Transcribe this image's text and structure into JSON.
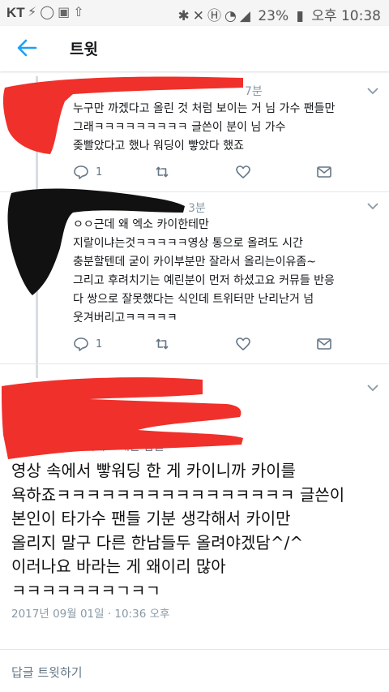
{
  "status_bar": {
    "carrier": "KT",
    "left_icons": [
      "notification-icon",
      "chat-icon",
      "image-icon",
      "upload-icon"
    ],
    "battery": "23%",
    "time": "오후 10:38",
    "right_icons": [
      "bluetooth-icon",
      "mute-icon",
      "hd-icon",
      "wifi-icon",
      "signal-icon",
      "battery-icon"
    ]
  },
  "app_bar": {
    "title": "트윗"
  },
  "tweets": [
    {
      "time": "7분",
      "lines": [
        "누구만 까겠다고 올린 것 처럼 보이는 거 님 가수 팬들만",
        "그래ㅋㅋㅋㅋㅋㅋㅋㅋㅋ 글쓴이 분이 님 가수",
        "좆빨았다고 했나 워딩이 빻았다 했죠"
      ],
      "reply_count": "1"
    },
    {
      "time": "3분",
      "lines": [
        "ㅇㅇ근데 왜 엑소 카이한테만",
        "지랄이냐는것ㅋㅋㅋㅋㅋ영상 통으로 올려도 시간",
        "충분할텐데 굳이 카이부분만 잘라서 올리는이유좀~",
        "그리고 후려치기는 예린분이 먼저 하셨고요 커뮤들 반응",
        "다 쌍으로 잘못했다는 식인데 트위터만 난리난거 넘",
        "웃겨버리고ㅋㅋㅋㅋㅋ"
      ],
      "reply_count": "1"
    }
  ],
  "main_tweet": {
    "reply_to": "에게 보내는 답글",
    "lines": [
      "영상 속에서 빻워딩 한 게 카이니까 카이를",
      "욕하죠ㅋㅋㅋㅋㅋㅋㅋㅋㅋㅋㅋㅋㅋㅋㅋㅋ 글쓴이",
      "본인이 타가수 팬들 기분 생각해서 카이만",
      "올리지 말구 다른 한남들두 올려야겠담^/^",
      "이러나요 바라는 게 왜이리 많아",
      "ㅋㅋㅋㅋㅋㅋㅋㄱㅋㄱ"
    ],
    "timestamp": "2017년 09월 01일 · 10:36 오후"
  },
  "reply_footer": "답글 트윗하기",
  "colors": {
    "accent": "#1da1f2",
    "icon_gray": "#657786",
    "red_scribble": "#f0302a",
    "black_scribble": "#111111"
  }
}
